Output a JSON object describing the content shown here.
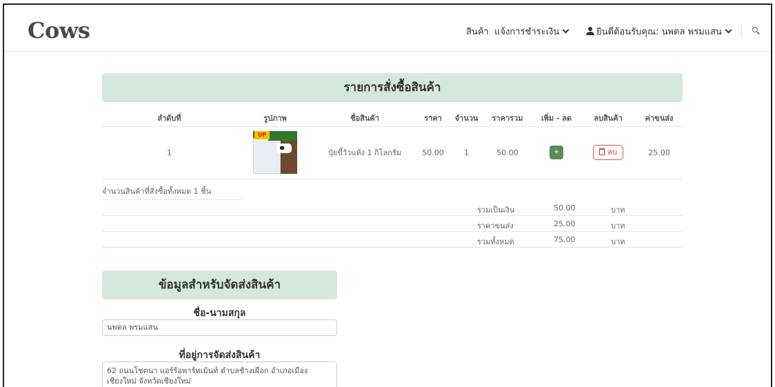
{
  "header": {
    "brand": "Cows",
    "nav_products": "สินค้า",
    "nav_payment": "แจ้งการชำระเงิน",
    "nav_user": "ยินดีต้อนรับคุณ: นพดล พรมแสน",
    "search_icon": "search-icon"
  },
  "order": {
    "title": "รายการสั่งซื้อสินค้า",
    "columns": [
      "ลำดับที่",
      "รูปภาพ",
      "ชื่อสินค้า",
      "ราคา",
      "จำนวน",
      "ราคารวม",
      "เพิ่ม - ลด",
      "ลบสินค้า",
      "ค่าขนส่ง"
    ],
    "rows": [
      {
        "no": "1",
        "image_badge": "UP",
        "name": "ปุ๋ยขี้วัวแห้ง 1 กิโลกรัม",
        "price": "50.00",
        "qty": "1",
        "total": "50.00",
        "plus_label": "+",
        "delete_label": "ลบ",
        "shipping": "25.00"
      }
    ],
    "item_count_text": "จำนวนสินค้าที่สั่งซื้อทั้งหมด 1 ชิ้น",
    "summary": [
      {
        "label": "รวมเป็นเงิน",
        "value": "50.00",
        "unit": "บาท"
      },
      {
        "label": "ราคาขนส่ง",
        "value": "25.00",
        "unit": "บาท"
      },
      {
        "label": "รวมทั้งหมด",
        "value": "75.00",
        "unit": "บาท"
      }
    ]
  },
  "shipping": {
    "title": "ข้อมูลสำหรับจัดส่งสินค้า",
    "name_label": "ชื่อ-นามสกุล",
    "name_value": "นพดล พรมแสน",
    "address_label": "ที่อยู่การจัดส่งสินค้า",
    "address_value": "62 ถนนโชตนา แอร์ร้อพาร์ทเม้นท์ ตำบลช้างเผือก อำเภอเมืองเชียงใหม่ จังหวัดเชียงใหม่"
  },
  "colors": {
    "section_header_bg": "#d4e8dc",
    "plus_button": "#5b8c5a",
    "delete_button": "#e05858"
  }
}
